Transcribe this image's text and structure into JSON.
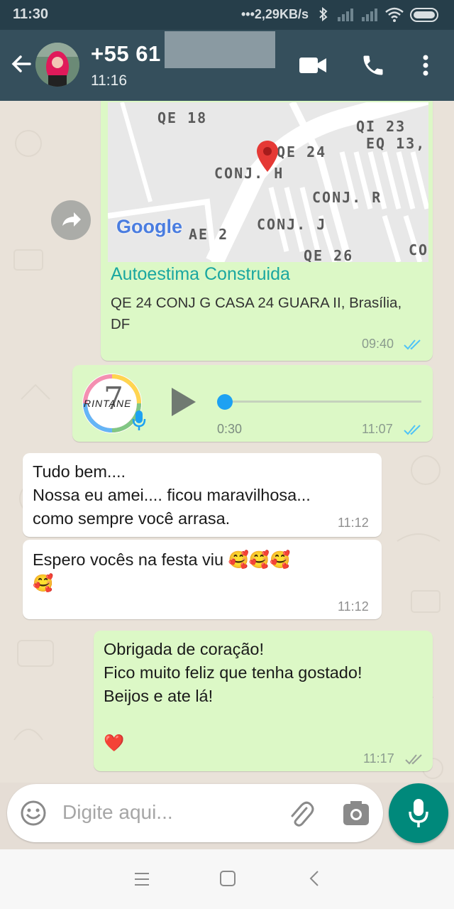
{
  "status_bar": {
    "time": "11:30",
    "network_speed": "•••2,29KB/s",
    "icons": [
      "bluetooth-icon",
      "signal-icon",
      "signal-icon",
      "wifi-icon",
      "battery-icon"
    ]
  },
  "header": {
    "contact_name": "+55 61",
    "last_seen": "11:16",
    "icons": [
      "back-arrow-icon",
      "video-call-icon",
      "phone-call-icon",
      "more-options-icon"
    ]
  },
  "messages": [
    {
      "type": "location",
      "direction": "outgoing",
      "map_labels": [
        "QE 18",
        "QI 23",
        "QE 24",
        "EQ 13,",
        "CONJ. H",
        "CONJ. R",
        "CONJ. J",
        "AE 2",
        "QE 26",
        "CO"
      ],
      "map_brand": "Google",
      "title": "Autoestima Construida",
      "address": "QE 24 CONJ G CASA 24 GUARA II, Brasília, DF",
      "time": "09:40",
      "ticks": "read"
    },
    {
      "type": "voice",
      "direction": "outgoing",
      "thumb_text": "RINTANE",
      "thumb_number": "7",
      "duration": "0:30",
      "time": "11:07",
      "ticks": "read"
    },
    {
      "type": "text",
      "direction": "incoming",
      "text": "Tudo bem....\nNossa eu amei.... ficou maravilhosa...\ncomo sempre você arrasa.",
      "time": "11:12"
    },
    {
      "type": "text",
      "direction": "incoming",
      "text": "Espero vocês na festa viu 🥰🥰🥰\n🥰",
      "time": "11:12"
    },
    {
      "type": "text",
      "direction": "outgoing",
      "text": "Obrigada de coração!\nFico muito feliz que tenha gostado!\nBeijos e ate lá!\n\n❤️",
      "time": "11:17",
      "ticks": "delivered"
    }
  ],
  "input": {
    "placeholder": "Digite aqui...",
    "icons": [
      "emoji-icon",
      "attach-icon",
      "camera-icon",
      "mic-icon"
    ]
  },
  "colors": {
    "header": "#354f5c",
    "status_bar": "#263e4a",
    "outgoing_bubble": "#dcf8c6",
    "incoming_bubble": "#ffffff",
    "read_ticks": "#4fc3f7",
    "accent": "#00897b",
    "location_title": "#1aa7a0"
  }
}
